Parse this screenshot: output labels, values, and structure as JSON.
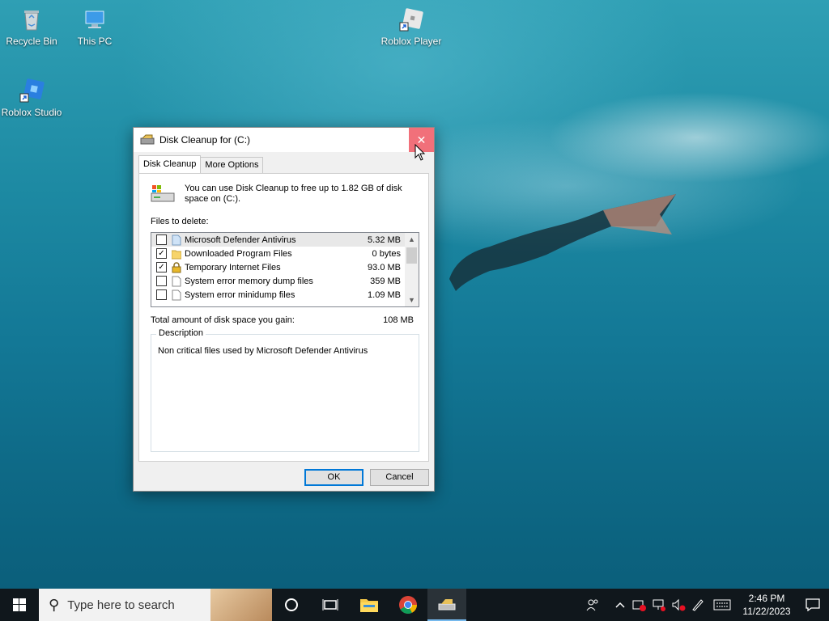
{
  "desktop": {
    "icons": [
      {
        "label": "Recycle Bin",
        "icon": "recycle-bin-icon"
      },
      {
        "label": "This PC",
        "icon": "computer-icon"
      },
      {
        "label": "Roblox Player",
        "icon": "roblox-player-icon"
      },
      {
        "label": "Roblox Studio",
        "icon": "roblox-studio-icon"
      }
    ]
  },
  "dialog": {
    "title": "Disk Cleanup for  (C:)",
    "close_glyph": "✕",
    "tabs": [
      "Disk Cleanup",
      "More Options"
    ],
    "intro": "You can use Disk Cleanup to free up to 1.82 GB of disk space on  (C:).",
    "files_label": "Files to delete:",
    "files": [
      {
        "name": "Microsoft Defender Antivirus",
        "size": "5.32 MB",
        "checked": false,
        "icon": "file-icon",
        "selected": true
      },
      {
        "name": "Downloaded Program Files",
        "size": "0 bytes",
        "checked": true,
        "icon": "folder-icon",
        "selected": false
      },
      {
        "name": "Temporary Internet Files",
        "size": "93.0 MB",
        "checked": true,
        "icon": "lock-icon",
        "selected": false
      },
      {
        "name": "System error memory dump files",
        "size": "359 MB",
        "checked": false,
        "icon": "file-icon",
        "selected": false
      },
      {
        "name": "System error minidump files",
        "size": "1.09 MB",
        "checked": false,
        "icon": "file-icon",
        "selected": false
      }
    ],
    "total_label": "Total amount of disk space you gain:",
    "total_value": "108 MB",
    "description_label": "Description",
    "description_text": "Non critical files used by Microsoft Defender Antivirus",
    "ok_label": "OK",
    "cancel_label": "Cancel"
  },
  "taskbar": {
    "search_placeholder": "Type here to search",
    "time": "2:46 PM",
    "date": "11/22/2023"
  },
  "colors": {
    "accent": "#0078d7",
    "close_hover": "#f1707a",
    "taskbar": "#10171c"
  }
}
